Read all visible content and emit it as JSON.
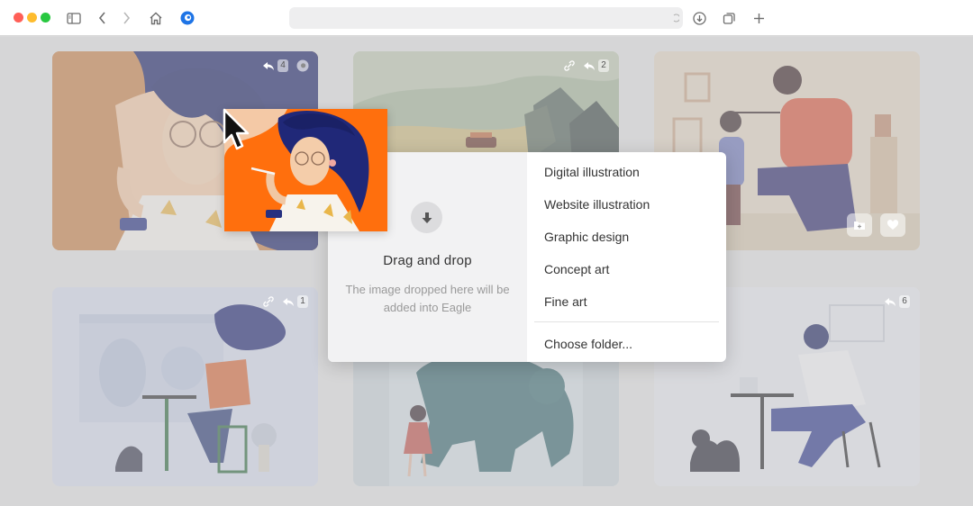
{
  "browser": {
    "traffic_colors": [
      "#ff5f57",
      "#febc2e",
      "#28c840"
    ],
    "icons": [
      "sidebar-icon",
      "back-chevron-icon",
      "forward-chevron-icon",
      "home-icon",
      "eagle-extension-icon",
      "download-icon",
      "tabs-icon",
      "new-tab-icon"
    ]
  },
  "gallery": {
    "tiles": [
      {
        "badge": "4"
      },
      {
        "badge": "2"
      },
      {
        "badge": ""
      },
      {
        "badge": "1"
      },
      {
        "badge": ""
      },
      {
        "badge": "6"
      }
    ]
  },
  "drop_zone": {
    "title": "Drag and drop",
    "subtitle": "The image dropped here will be added into Eagle"
  },
  "menu": {
    "items": [
      {
        "label": "Digital illustration"
      },
      {
        "label": "Website illustration"
      },
      {
        "label": "Graphic design"
      },
      {
        "label": "Concept art"
      },
      {
        "label": "Fine art"
      }
    ],
    "choose_folder": "Choose folder..."
  },
  "colors": {
    "accent_blue": "#1e74e6",
    "illustration_orange": "#ff6f0d",
    "hair_navy": "#202878"
  }
}
